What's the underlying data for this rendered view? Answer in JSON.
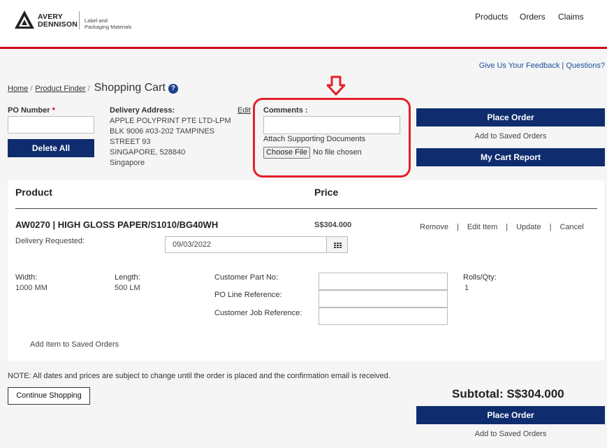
{
  "header": {
    "logo_line1": "AVERY",
    "logo_line2": "DENNISON",
    "logo_sub1": "Label and",
    "logo_sub2": "Packaging Materials",
    "nav": [
      "Products",
      "Orders",
      "Claims"
    ]
  },
  "feedback": {
    "feedback_label": "Give Us Your Feedback",
    "separator": " | ",
    "questions_label": "Questions?"
  },
  "breadcrumb": {
    "home": "Home",
    "product_finder": "Product Finder",
    "current": "Shopping Cart",
    "help_glyph": "?"
  },
  "po": {
    "label": "PO Number",
    "required_mark": "*",
    "value": ""
  },
  "delete_all_label": "Delete All",
  "delivery": {
    "label": "Delivery Address:",
    "lines": [
      "APPLE POLYPRINT PTE LTD-LPM",
      "BLK 9006 #03-202 TAMPINES",
      "STREET 93",
      "SINGAPORE, 528840",
      "Singapore"
    ],
    "edit_label": "Edit"
  },
  "comments": {
    "label": "Comments :",
    "value": "",
    "attach_label": "Attach Supporting Documents",
    "choose_file_label": "Choose File",
    "no_file_label": "No file chosen"
  },
  "actions_top": {
    "place_order": "Place Order",
    "add_saved": "Add to Saved Orders",
    "cart_report": "My Cart Report"
  },
  "cart": {
    "col_product": "Product",
    "col_price": "Price",
    "item": {
      "title": "AW0270 | HIGH GLOSS PAPER/S1010/BG40WH",
      "price": "S$304.000",
      "delivery_label": "Delivery Requested:",
      "delivery_date": "09/03/2022",
      "actions": [
        "Remove",
        "Edit Item",
        "Update",
        "Cancel"
      ],
      "width_label": "Width:",
      "width_value": "1000 MM",
      "length_label": "Length:",
      "length_value": "500 LM",
      "cust_part_label": "Customer Part No:",
      "po_line_label": "PO Line Reference:",
      "cust_job_label": "Customer Job Reference:",
      "rolls_label": "Rolls/Qty:",
      "rolls_value": "1",
      "add_saved_label": "Add Item to Saved Orders"
    }
  },
  "note": "NOTE: All dates and prices are subject to change until the order is placed and the confirmation email is received.",
  "continue_label": "Continue Shopping",
  "subtotal": "Subtotal: S$304.000",
  "actions_bottom": {
    "place_order": "Place Order",
    "add_saved": "Add to Saved Orders"
  },
  "colors": {
    "brand_blue": "#0f2d6e",
    "accent_red": "#d0021b",
    "link_blue": "#1b4e9b"
  }
}
